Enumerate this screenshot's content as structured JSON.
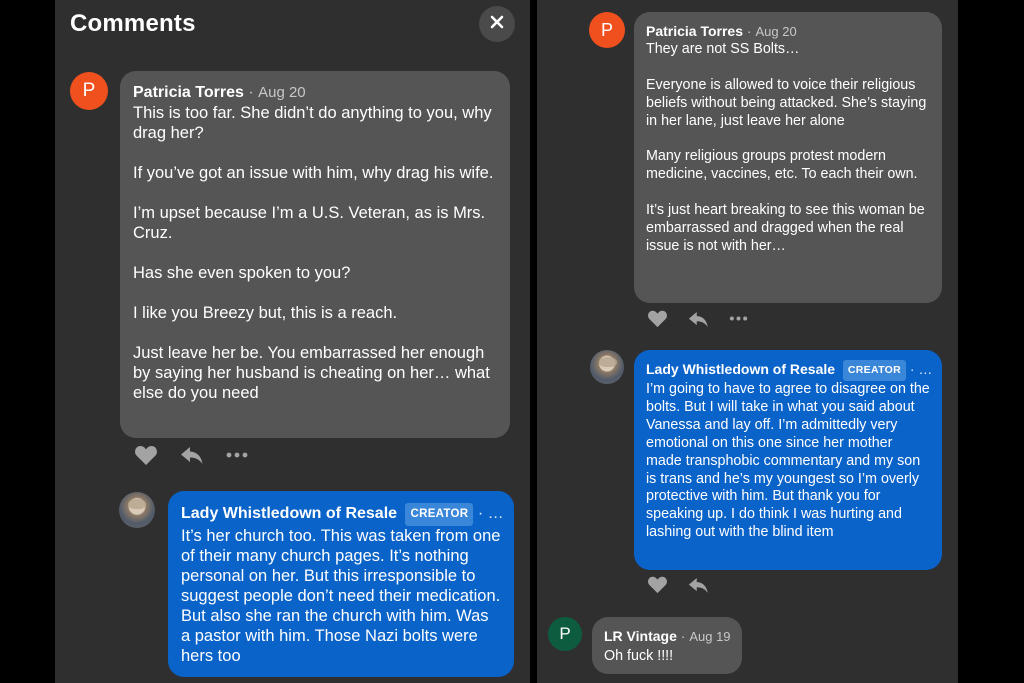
{
  "header": {
    "title": "Comments"
  },
  "left": {
    "comments": [
      {
        "avatar_letter": "P",
        "author": "Patricia Torres",
        "separator": "·",
        "date": "Aug 20",
        "text": "This is too far. She didn’t do anything to you, why drag her?\n\nIf you’ve got an issue with him, why drag his wife.\n\nI’m upset because I’m a U.S. Veteran, as is Mrs. Cruz.\n\nHas she even spoken to you?\n\nI like you Breezy but, this is a reach.\n\nJust leave her be. You embarrassed her enough by saying her husband is cheating on her… what else do you need"
      },
      {
        "author": "Lady Whistledown of Resale",
        "badge": "CREATOR",
        "separator": "· …",
        "text": "It’s her church too. This was taken from one of their many church pages. It’s nothing personal on her. But this irresponsible to suggest people don’t need their medication. But also she ran the church with him. Was a pastor with him. Those Nazi bolts were hers too"
      }
    ]
  },
  "right": {
    "comments": [
      {
        "avatar_letter": "P",
        "author": "Patricia Torres",
        "separator": "·",
        "date": "Aug 20",
        "text": "They are not SS Bolts…\n\nEveryone is allowed to voice their religious beliefs without being attacked. She’s staying in her lane, just leave her alone\n\nMany religious groups protest modern medicine, vaccines, etc. To each their own.\n\nIt’s just heart breaking to see this woman be embarrassed and dragged when the real issue is not with her…"
      },
      {
        "author": "Lady Whistledown of Resale",
        "badge": "CREATOR",
        "separator": "· …",
        "text": "I’m going to have to agree to disagree on the bolts. But I will take in what you said about Vanessa and lay off. I’m admittedly very emotional on this one since her mother made transphobic commentary and my son is trans and he’s my youngest so I’m overly protective with him. But thank you for speaking up. I do think I was hurting and lashing out with the blind item"
      },
      {
        "avatar_letter": "P",
        "author": "LR Vintage",
        "separator": "·",
        "date": "Aug 19",
        "text": "Oh fuck !!!!"
      }
    ]
  },
  "colors": {
    "panel_bg": "#2f2f2f",
    "gray_bubble": "#555555",
    "creator_bubble": "#0a63c9",
    "avatar_orange": "#f0501e",
    "avatar_green": "#0e5c3f"
  },
  "icons": [
    "close-icon",
    "heart-icon",
    "reply-icon",
    "more-icon"
  ]
}
